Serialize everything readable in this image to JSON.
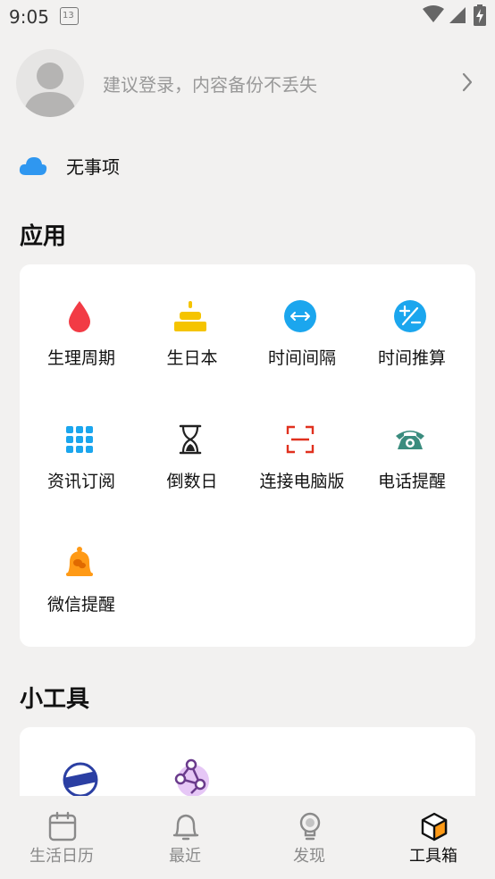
{
  "status_bar": {
    "time": "9:05",
    "calendar_day": "13"
  },
  "login": {
    "hint": "建议登录，内容备份不丢失"
  },
  "sync": {
    "label": "无事项"
  },
  "sections": {
    "apps": {
      "title": "应用",
      "items": [
        {
          "label": "生理周期",
          "icon": "drop-icon"
        },
        {
          "label": "生日本",
          "icon": "cake-icon"
        },
        {
          "label": "时间间隔",
          "icon": "interval-icon"
        },
        {
          "label": "时间推算",
          "icon": "plus-minus-icon"
        },
        {
          "label": "资讯订阅",
          "icon": "grid-icon"
        },
        {
          "label": "倒数日",
          "icon": "hourglass-icon"
        },
        {
          "label": "连接电脑版",
          "icon": "scan-icon"
        },
        {
          "label": "电话提醒",
          "icon": "phone-icon"
        },
        {
          "label": "微信提醒",
          "icon": "bell-wechat-icon"
        }
      ]
    },
    "tools": {
      "title": "小工具"
    }
  },
  "tab_bar": {
    "tabs": [
      {
        "label": "生活日历",
        "icon": "calendar-icon"
      },
      {
        "label": "最近",
        "icon": "bell-icon"
      },
      {
        "label": "发现",
        "icon": "bulb-icon"
      },
      {
        "label": "工具箱",
        "icon": "box-icon",
        "active": true
      }
    ]
  },
  "colors": {
    "background": "#f2f1f0",
    "card": "#ffffff",
    "accent_blue": "#1ba6ee",
    "drop_red": "#f23b45",
    "cake_yellow": "#f5c400",
    "scan_red": "#e0301e",
    "phone_teal": "#3a8c7e",
    "bell_orange": "#ff9a16"
  }
}
